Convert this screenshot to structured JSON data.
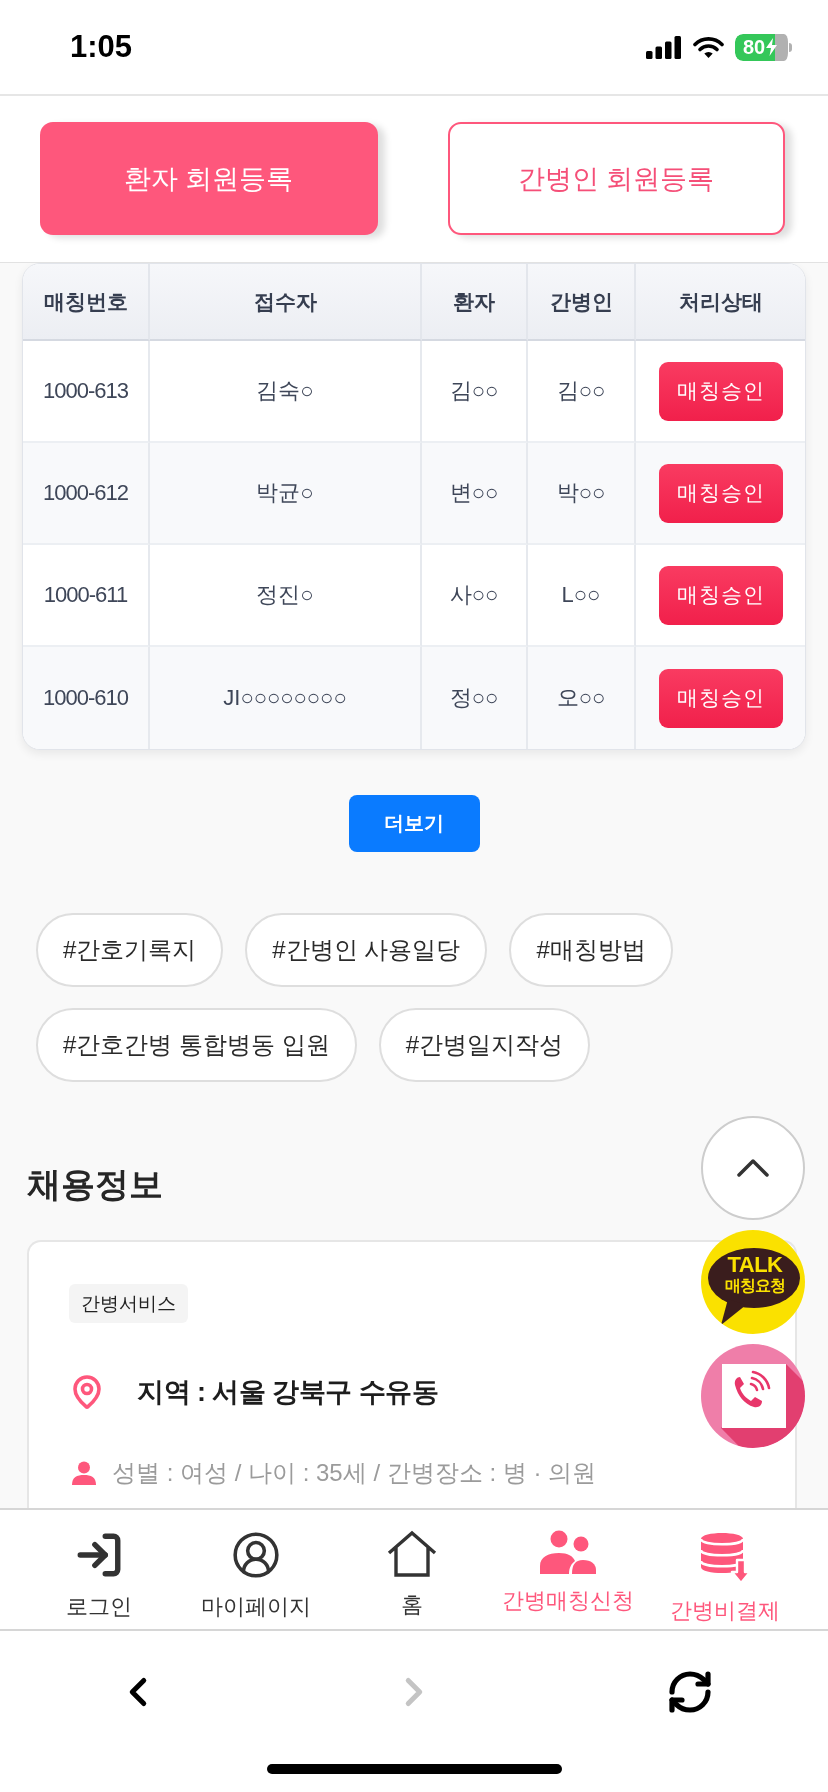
{
  "status_bar": {
    "time": "1:05",
    "battery": "80"
  },
  "register_buttons": [
    {
      "label": "환자 회원등록",
      "kind": "filled"
    },
    {
      "label": "간병인 회원등록",
      "kind": "outline"
    }
  ],
  "matching_table": {
    "columns": [
      "매칭번호",
      "접수자",
      "환자",
      "간병인",
      "처리상태"
    ],
    "rows": [
      {
        "number": "1000-613",
        "applicant": "김숙○",
        "patient": "김○○",
        "caregiver": "김○○",
        "status": "매칭승인"
      },
      {
        "number": "1000-612",
        "applicant": "박균○",
        "patient": "변○○",
        "caregiver": "박○○",
        "status": "매칭승인"
      },
      {
        "number": "1000-611",
        "applicant": "정진○",
        "patient": "사○○",
        "caregiver": "L○○",
        "status": "매칭승인"
      },
      {
        "number": "1000-610",
        "applicant": "JI○○○○○○○○",
        "patient": "정○○",
        "caregiver": "오○○",
        "status": "매칭승인"
      }
    ]
  },
  "more_button": "더보기",
  "hashtags": [
    "#간호기록지",
    "#간병인 사용일당",
    "#매칭방법",
    "#간호간병 통합병동 입원",
    "#간병일지작성"
  ],
  "job_section": {
    "title": "채용정보",
    "card": {
      "category": "간병서비스",
      "region": "지역 : 서울 강북구 수유동",
      "details": "성별 : 여성 / 나이 : 35세 / 간병장소 : 병 · 의원"
    }
  },
  "floating_buttons": [
    {
      "kind": "scroll_top"
    },
    {
      "kind": "kakao_talk",
      "title": "TALK",
      "label": "매칭요청"
    },
    {
      "kind": "phone"
    }
  ],
  "bottom_nav": [
    {
      "kind": "login",
      "label": "로그인",
      "highlighted": false
    },
    {
      "kind": "mypage",
      "label": "마이페이지",
      "highlighted": false
    },
    {
      "kind": "home",
      "label": "홈",
      "highlighted": false
    },
    {
      "kind": "matching",
      "label": "간병매칭신청",
      "highlighted": true
    },
    {
      "kind": "payment",
      "label": "간병비결제",
      "highlighted": true
    }
  ],
  "browser_toolbar": {
    "back_disabled": false,
    "forward_disabled": true
  }
}
